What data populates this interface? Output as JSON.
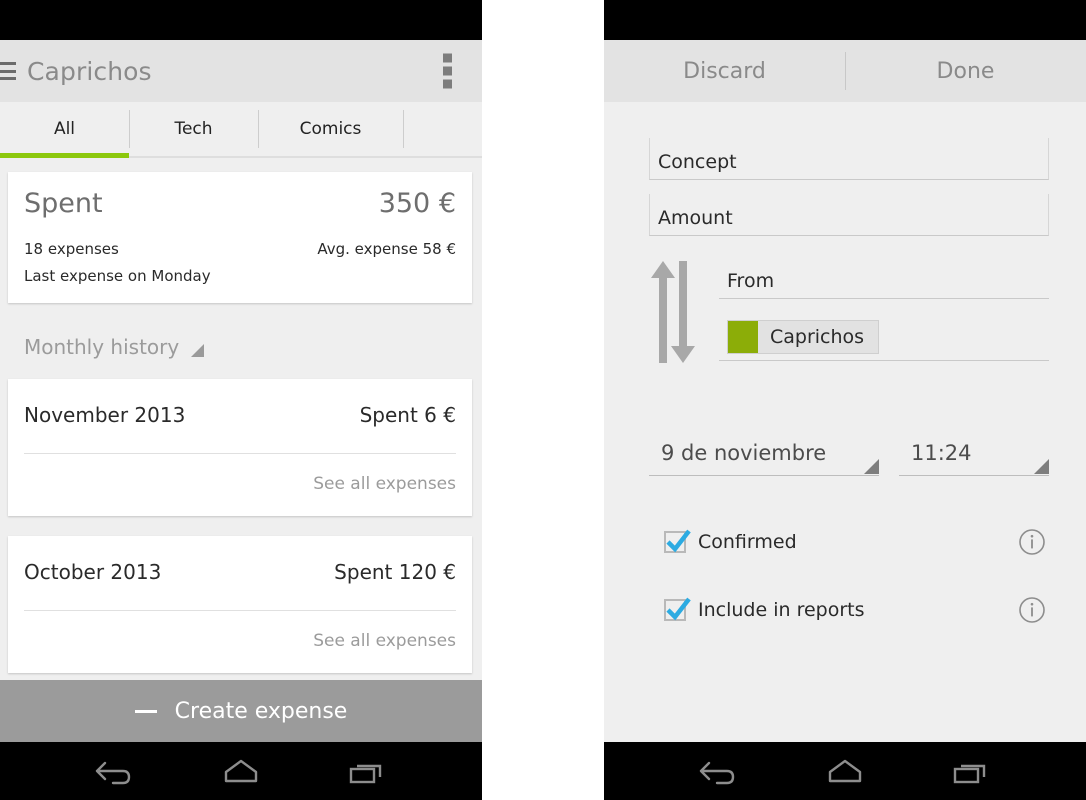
{
  "colors": {
    "accent_green": "#8cc80d",
    "category_swatch": "#8cad08",
    "checkbox_check": "#2cabe2",
    "panel_bg": "#efefef",
    "bar_bg": "#e3e3e3",
    "create_bar_bg": "#9b9b9b",
    "card_bg": "#ffffff",
    "status_bar": "#000000"
  },
  "left_phone": {
    "action_bar": {
      "menu_icon": "hamburger-icon",
      "title": "Caprichos",
      "overflow_icon": "overflow-menu-icon"
    },
    "tabs": [
      {
        "label": "All",
        "selected": true
      },
      {
        "label": "Tech",
        "selected": false
      },
      {
        "label": "Comics",
        "selected": false
      }
    ],
    "summary_card": {
      "label": "Spent",
      "amount": "350 €",
      "expense_count": "18 expenses",
      "average": "Avg. expense 58 €",
      "last_expense": "Last expense on Monday"
    },
    "section": {
      "title": "Monthly history",
      "spinner_icon": "spinner-triangle-icon"
    },
    "months": [
      {
        "name": "November 2013",
        "spent": "Spent 6 €",
        "link": "See all expenses"
      },
      {
        "name": "October 2013",
        "spent": "Spent 120 €",
        "link": "See all expenses"
      }
    ],
    "create_bar": {
      "icon": "minus-icon",
      "label": "Create expense"
    }
  },
  "right_phone": {
    "action_bar": {
      "discard": "Discard",
      "done": "Done"
    },
    "form": {
      "concept": {
        "value": "Concept"
      },
      "amount": {
        "value": "Amount"
      },
      "from": {
        "value": "From"
      },
      "swap_icon": "swap-vertical-arrows-icon",
      "category": {
        "swatch_icon": "color-swatch-icon",
        "name": "Caprichos"
      },
      "date": {
        "value": "9 de noviembre",
        "icon": "spinner-triangle-icon"
      },
      "time": {
        "value": "11:24",
        "icon": "spinner-triangle-icon"
      },
      "checkboxes": [
        {
          "label": "Confirmed",
          "checked": true,
          "info_icon": "info-icon"
        },
        {
          "label": "Include in reports",
          "checked": true,
          "info_icon": "info-icon"
        }
      ]
    }
  },
  "navbar": {
    "back": "back-icon",
    "home": "home-icon",
    "recents": "recents-icon"
  }
}
